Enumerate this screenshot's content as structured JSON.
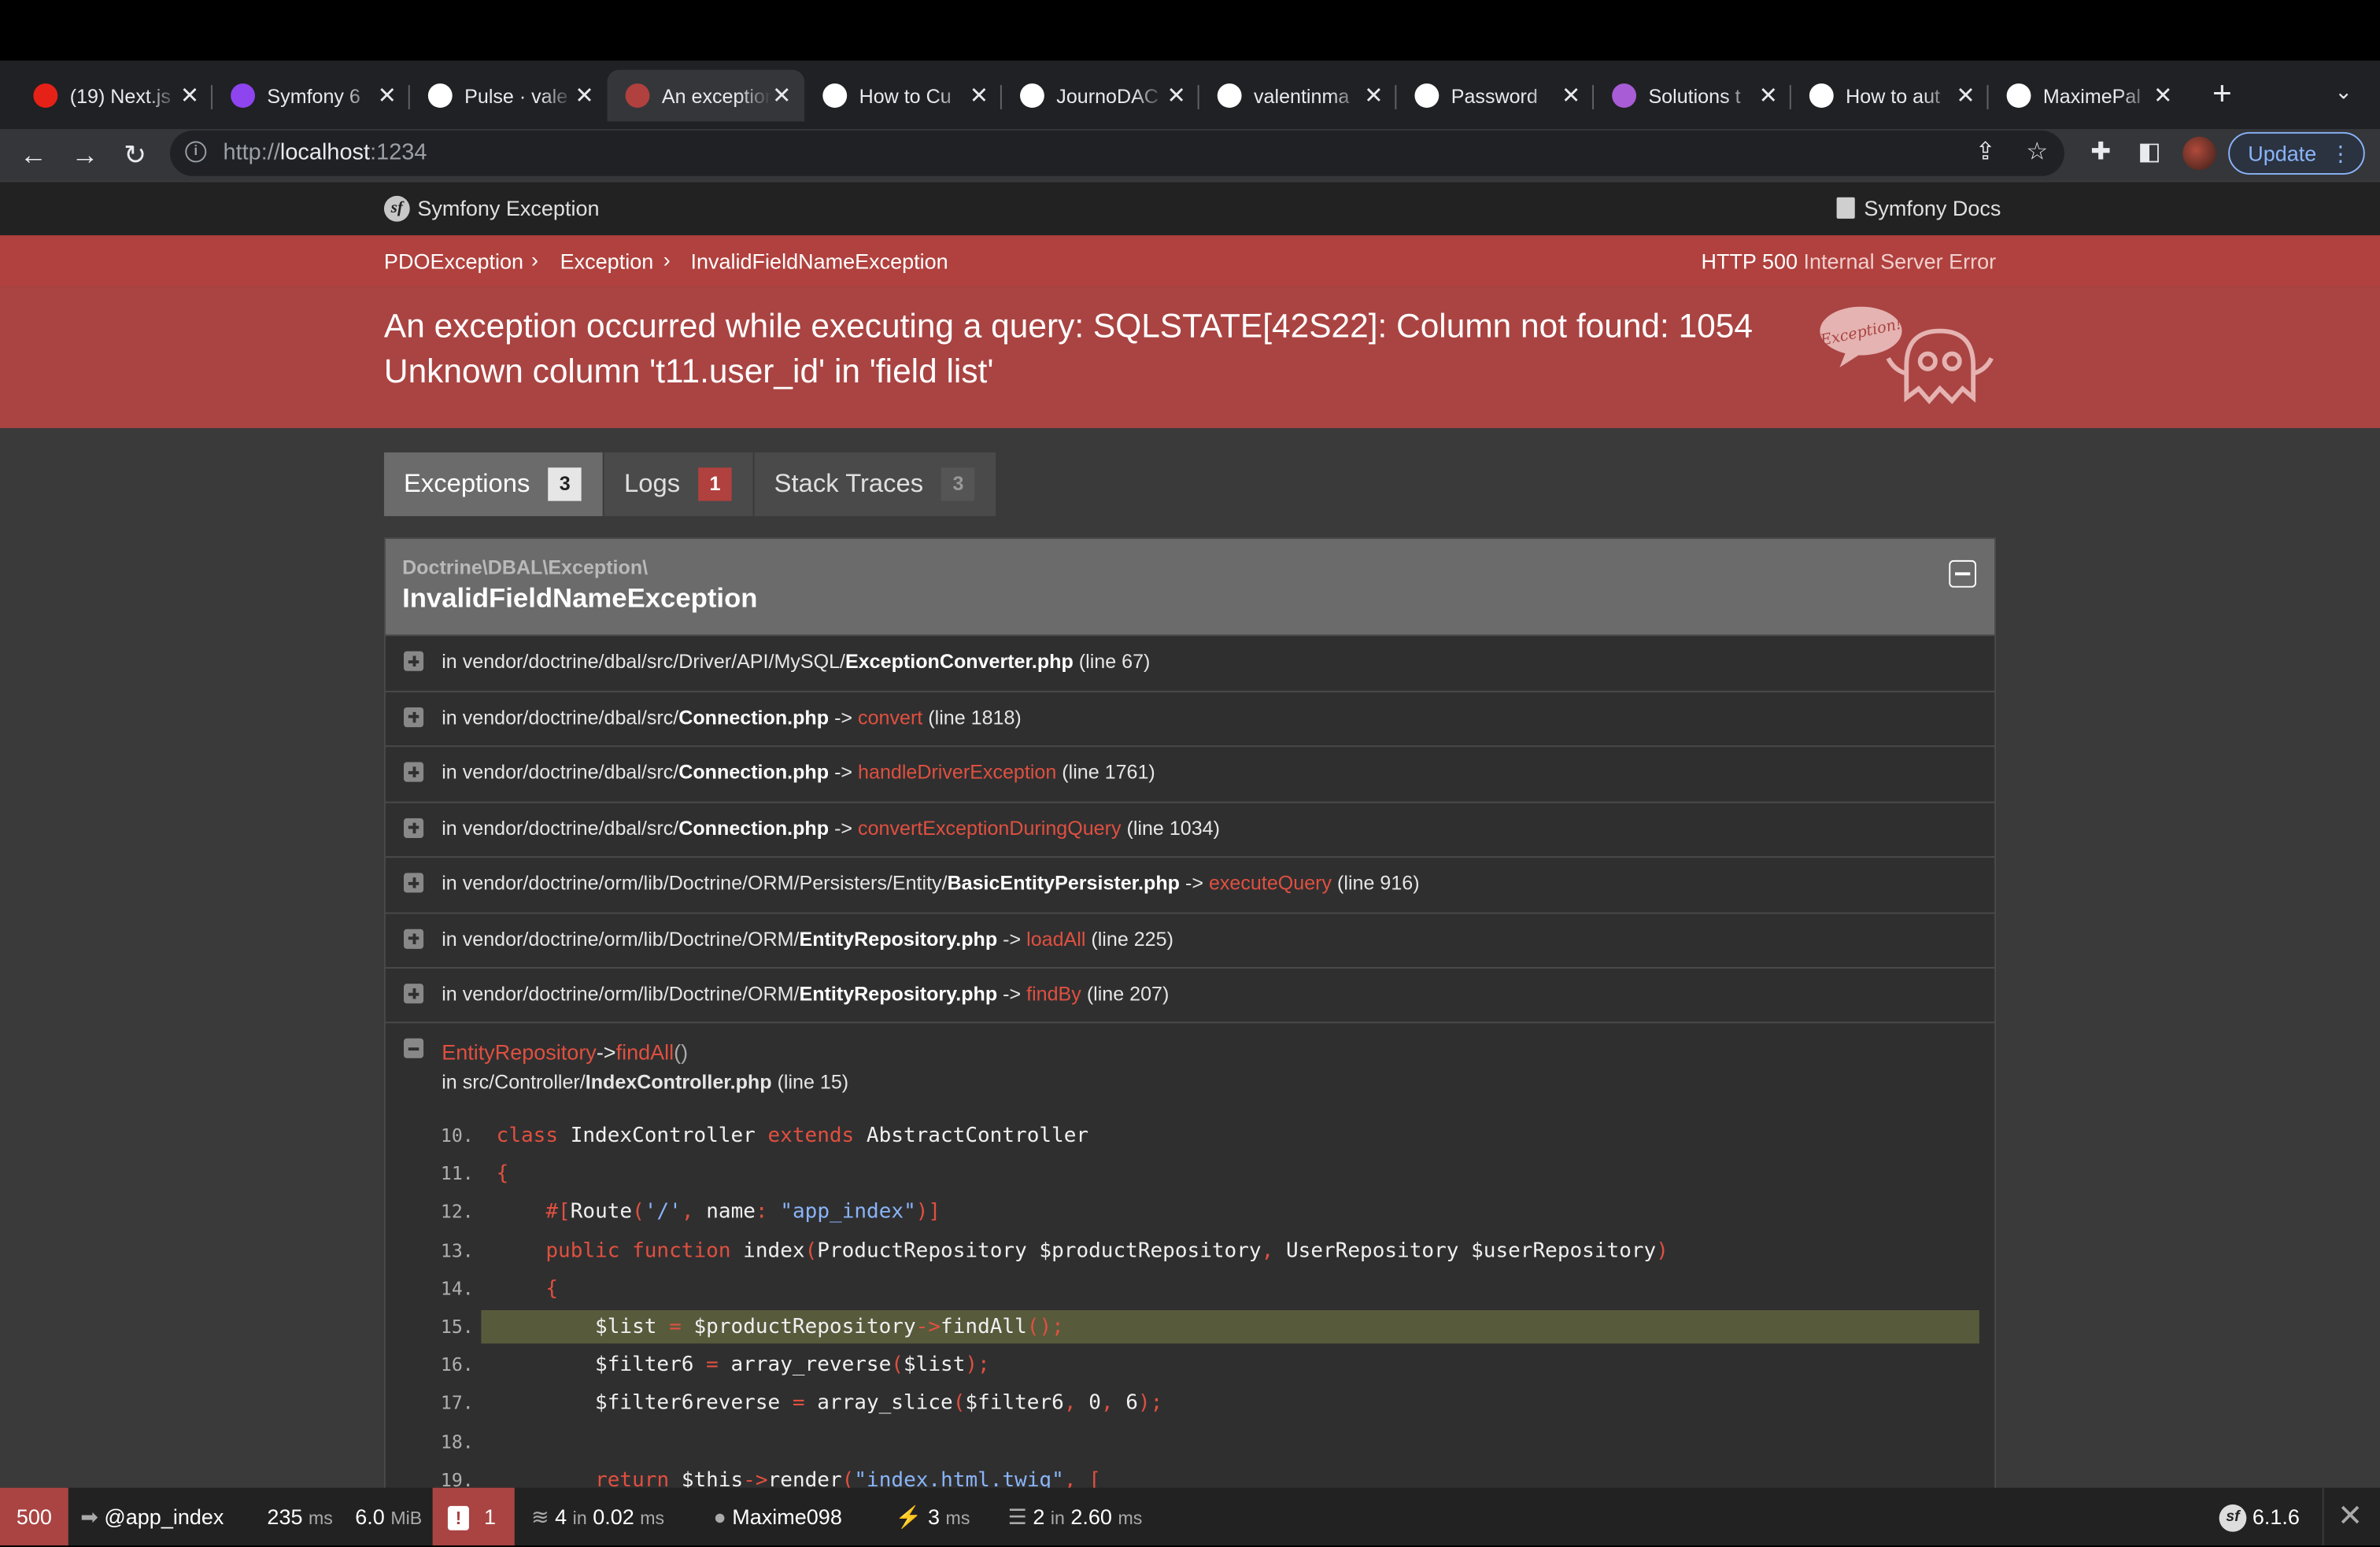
{
  "browser": {
    "tabs": [
      {
        "title": "(19) Next.js",
        "favicon": "youtube-icon",
        "color": "#e62117",
        "active": false
      },
      {
        "title": "Symfony 6",
        "favicon": "ublock-icon",
        "color": "#8e44ef",
        "active": false
      },
      {
        "title": "Pulse · vale",
        "favicon": "github-icon",
        "color": "#ffffff",
        "active": false
      },
      {
        "title": "An exception",
        "favicon": "symfony-ghost-icon",
        "color": "#b0413e",
        "active": true
      },
      {
        "title": "How to Cu",
        "favicon": "symfony-icon",
        "color": "#ffffff",
        "active": false
      },
      {
        "title": "JournoDAC",
        "favicon": "journo-icon",
        "color": "#ffffff",
        "active": false
      },
      {
        "title": "valentinma",
        "favicon": "github-icon",
        "color": "#ffffff",
        "active": false
      },
      {
        "title": "Password",
        "favicon": "symfony-icon",
        "color": "#ffffff",
        "active": false
      },
      {
        "title": "Solutions t",
        "favicon": "medium-icon",
        "color": "#a85cd6",
        "active": false
      },
      {
        "title": "How to aut",
        "favicon": "dev-icon",
        "color": "#ffffff",
        "active": false
      },
      {
        "title": "MaximePal",
        "favicon": "github-icon",
        "color": "#ffffff",
        "active": false
      }
    ],
    "url_prefix": "http://",
    "url_host": "localhost",
    "url_suffix": ":1234",
    "update_label": "Update"
  },
  "header": {
    "title": "Symfony Exception",
    "docs_label": "Symfony Docs"
  },
  "breadcrumb": [
    "PDOException",
    "Exception",
    "InvalidFieldNameException"
  ],
  "http": {
    "code": "HTTP 500",
    "text": "Internal Server Error"
  },
  "exception_message": "An exception occurred while executing a query: SQLSTATE[42S22]: Column not found: 1054 Unknown column 't11.user_id' in 'field list'",
  "ghost_label": "Exception!",
  "tabs": [
    {
      "label": "Exceptions",
      "count": "3"
    },
    {
      "label": "Logs",
      "count": "1"
    },
    {
      "label": "Stack Traces",
      "count": "3"
    }
  ],
  "exception": {
    "namespace": "Doctrine\\DBAL\\Exception\\",
    "class": "InvalidFieldNameException"
  },
  "trace": [
    {
      "prefix": "in ",
      "path": "vendor/doctrine/dbal/src/Driver/API/MySQL/",
      "file": "ExceptionConverter.php",
      "arrow": "",
      "fn": "",
      "line": "(line 67)"
    },
    {
      "prefix": "in ",
      "path": "vendor/doctrine/dbal/src/",
      "file": "Connection.php",
      "arrow": "->",
      "fn": "convert",
      "line": "(line 1818)"
    },
    {
      "prefix": "in ",
      "path": "vendor/doctrine/dbal/src/",
      "file": "Connection.php",
      "arrow": "->",
      "fn": "handleDriverException",
      "line": "(line 1761)"
    },
    {
      "prefix": "in ",
      "path": "vendor/doctrine/dbal/src/",
      "file": "Connection.php",
      "arrow": "->",
      "fn": "convertExceptionDuringQuery",
      "line": "(line 1034)"
    },
    {
      "prefix": "in ",
      "path": "vendor/doctrine/orm/lib/Doctrine/ORM/Persisters/Entity/",
      "file": "BasicEntityPersister.php",
      "arrow": "->",
      "fn": "executeQuery",
      "line": "(line 916)"
    },
    {
      "prefix": "in ",
      "path": "vendor/doctrine/orm/lib/Doctrine/ORM/",
      "file": "EntityRepository.php",
      "arrow": "->",
      "fn": "loadAll",
      "line": "(line 225)"
    },
    {
      "prefix": "in ",
      "path": "vendor/doctrine/orm/lib/Doctrine/ORM/",
      "file": "EntityRepository.php",
      "arrow": "->",
      "fn": "findBy",
      "line": "(line 207)"
    }
  ],
  "expanded": {
    "class": "EntityRepository",
    "arrow": "->",
    "method": "findAll",
    "parens": "()",
    "file_prefix": "in src/Controller/",
    "file": "IndexController.php",
    "line": "(line 15)"
  },
  "code": [
    {
      "n": "10.",
      "html": "<span class=\"kw\">class</span> IndexController <span class=\"kw\">extends</span> AbstractController"
    },
    {
      "n": "11.",
      "html": "<span class=\"op\">{</span>"
    },
    {
      "n": "12.",
      "html": "    <span class=\"op\">#[</span>Route<span class=\"op\">(</span><span class=\"str\">'/'</span><span class=\"op\">,</span> name<span class=\"op\">:</span> <span class=\"str\">\"app_index\"</span><span class=\"op\">)]</span>"
    },
    {
      "n": "13.",
      "html": "    <span class=\"kw\">public function</span> index<span class=\"op\">(</span>ProductRepository $productRepository<span class=\"op\">,</span> UserRepository $userRepository<span class=\"op\">)</span>"
    },
    {
      "n": "14.",
      "html": "    <span class=\"op\">{</span>"
    },
    {
      "n": "15.",
      "html": "        $list <span class=\"op\">=</span> $productRepository<span class=\"op\">-></span>findAll<span class=\"op\">();</span>",
      "hl": true
    },
    {
      "n": "16.",
      "html": "        $filter6 <span class=\"op\">=</span> array_reverse<span class=\"op\">(</span>$list<span class=\"op\">);</span>"
    },
    {
      "n": "17.",
      "html": "        $filter6reverse <span class=\"op\">=</span> array_slice<span class=\"op\">(</span>$filter6<span class=\"op\">,</span> 0<span class=\"op\">,</span> 6<span class=\"op\">);</span>"
    },
    {
      "n": "18.",
      "html": ""
    },
    {
      "n": "19.",
      "html": "        <span class=\"kw\">return</span> $this<span class=\"op\">-></span>render<span class=\"op\">(</span><span class=\"str\">\"index.html.twig\"</span><span class=\"op\">,</span> <span class=\"op\">[</span>"
    }
  ],
  "debug_toolbar": {
    "status": "500",
    "route_at": "@",
    "route": "app_index",
    "time_value": "235",
    "time_unit": "ms",
    "memory_value": "6.0",
    "memory_unit": "MiB",
    "errors": "1",
    "twig_count": "4",
    "twig_in": "in",
    "twig_time": "0.02",
    "twig_unit": "ms",
    "user": "Maxime098",
    "http_time": "3",
    "http_unit": "ms",
    "db_count": "2",
    "db_in": "in",
    "db_time": "2.60",
    "db_unit": "ms",
    "sf_version": "6.1.6"
  }
}
